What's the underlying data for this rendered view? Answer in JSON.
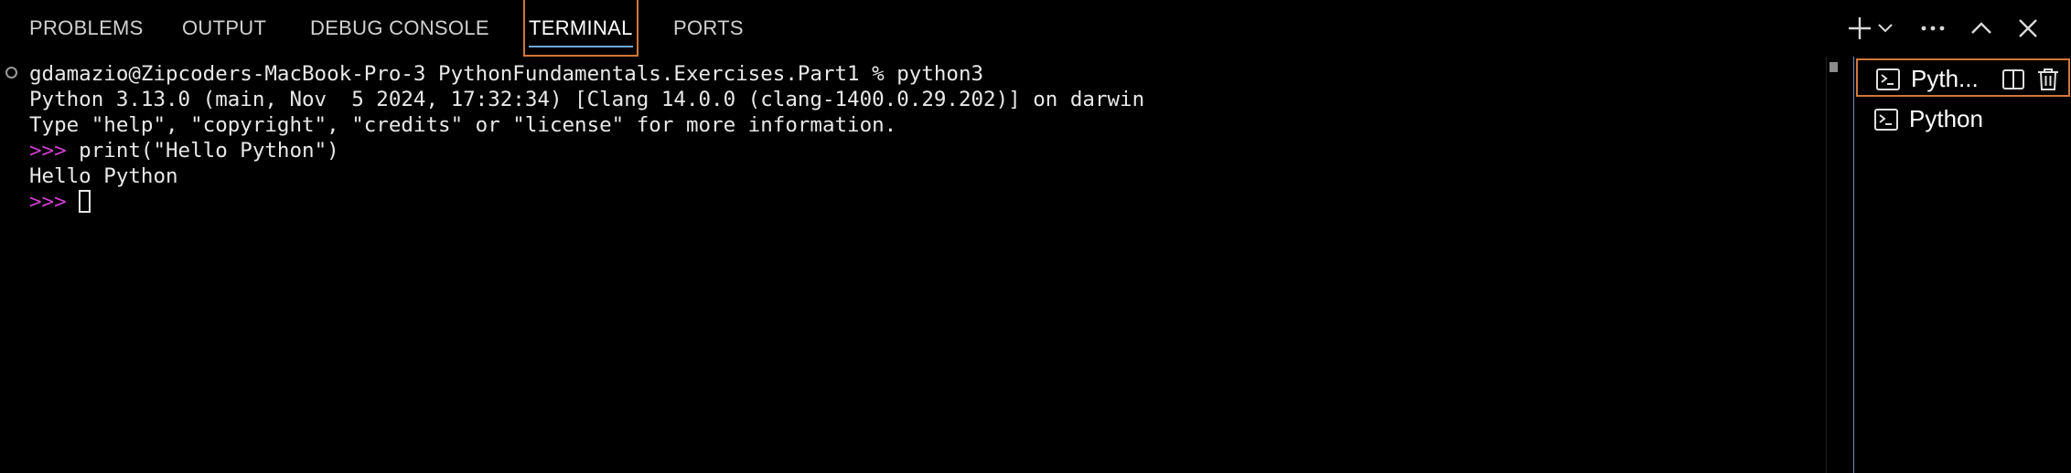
{
  "colors": {
    "background": "#000000",
    "active_border": "#d2773a",
    "active_underline": "#6fa8dc",
    "prompt": "#d43fd4",
    "divider": "#6f8fb4"
  },
  "tabs": [
    {
      "label": "PROBLEMS",
      "active": false
    },
    {
      "label": "OUTPUT",
      "active": false
    },
    {
      "label": "DEBUG CONSOLE",
      "active": false
    },
    {
      "label": "TERMINAL",
      "active": true
    },
    {
      "label": "PORTS",
      "active": false
    }
  ],
  "actions": {
    "new_terminal": "plus-icon",
    "launch_profile": "chevron-down-icon",
    "more": "ellipsis-icon",
    "maximize": "chevron-up-icon",
    "close": "close-icon"
  },
  "terminal": {
    "command_line": "gdamazio@Zipcoders-MacBook-Pro-3 PythonFundamentals.Exercises.Part1 % python3",
    "version_line": "Python 3.13.0 (main, Nov  5 2024, 17:32:34) [Clang 14.0.0 (clang-1400.0.29.202)] on darwin",
    "help_line": "Type \"help\", \"copyright\", \"credits\" or \"license\" for more information.",
    "prompt": ">>>",
    "input_1": " print(\"Hello Python\")",
    "output_1": "Hello Python",
    "prompt_2": ">>>"
  },
  "terminal_list": [
    {
      "label": "Pyth...",
      "icon": "terminal-icon",
      "selected": true,
      "split_icon": "split-terminal-icon",
      "delete_icon": "trash-icon"
    },
    {
      "label": "Python",
      "icon": "terminal-icon",
      "selected": false
    }
  ]
}
